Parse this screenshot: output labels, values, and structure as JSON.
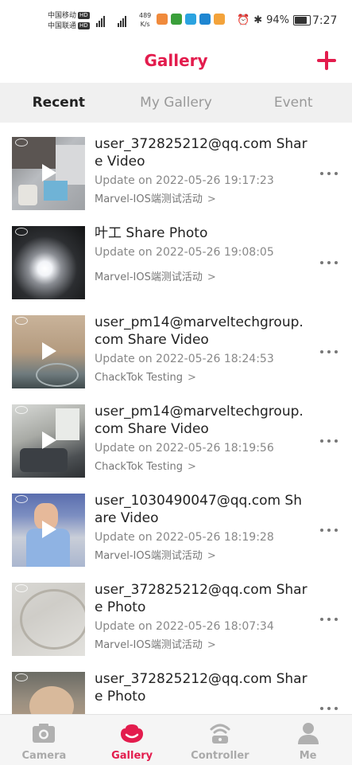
{
  "status_bar": {
    "carrier_1": "中国移动",
    "carrier_2": "中国联通",
    "hd": "HD",
    "net_speed_value": "489",
    "net_speed_unit": "K/s",
    "battery": "94%",
    "time": "7:27"
  },
  "header": {
    "title": "Gallery",
    "add_icon": "plus-icon"
  },
  "tabs": [
    {
      "label": "Recent",
      "active": true
    },
    {
      "label": "My Gallery",
      "active": false
    },
    {
      "label": "Event",
      "active": false
    }
  ],
  "items": [
    {
      "name": "user_372825212@qq.com Share Video",
      "date": "Update on 2022-05-26 19:17:23",
      "event": "Marvel-IOS端测试活动",
      "type": "video"
    },
    {
      "name": "叶工 Share Photo",
      "date": "Update on 2022-05-26 19:08:05",
      "event": "Marvel-IOS端测试活动",
      "type": "photo"
    },
    {
      "name": "user_pm14@marveltechgroup.com Share Video",
      "date": "Update on 2022-05-26 18:24:53",
      "event": "ChackTok Testing",
      "type": "video"
    },
    {
      "name": "user_pm14@marveltechgroup.com Share Video",
      "date": "Update on 2022-05-26 18:19:56",
      "event": "ChackTok Testing",
      "type": "video"
    },
    {
      "name": "user_1030490047@qq.com Share Video",
      "date": "Update on 2022-05-26 18:19:28",
      "event": "Marvel-IOS端测试活动",
      "type": "video"
    },
    {
      "name": "user_372825212@qq.com Share Photo",
      "date": "Update on 2022-05-26 18:07:34",
      "event": "Marvel-IOS端测试活动",
      "type": "photo"
    },
    {
      "name": "user_372825212@qq.com Share Photo",
      "date": "",
      "event": "",
      "type": "photo"
    }
  ],
  "event_arrow": ">",
  "bottom_nav": [
    {
      "label": "Camera",
      "icon": "camera-icon",
      "active": false
    },
    {
      "label": "Gallery",
      "icon": "gallery-icon",
      "active": true
    },
    {
      "label": "Controller",
      "icon": "controller-icon",
      "active": false
    },
    {
      "label": "Me",
      "icon": "person-icon",
      "active": false
    }
  ],
  "colors": {
    "accent": "#e31c4d",
    "tab_bar_bg": "#f0f0f0",
    "inactive_text": "#999999"
  }
}
